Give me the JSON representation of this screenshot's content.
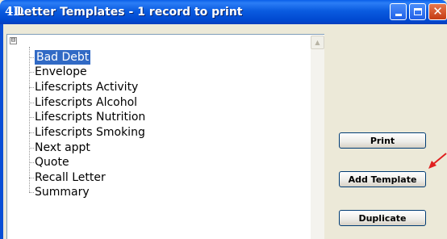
{
  "window": {
    "app_logo": "4D",
    "title": "Letter Templates - 1 record to print"
  },
  "tree": {
    "root_toggle": "⊟",
    "items": [
      {
        "label": "Bad Debt",
        "selected": true
      },
      {
        "label": "Envelope"
      },
      {
        "label": "Lifescripts Activity"
      },
      {
        "label": "Lifescripts Alcohol"
      },
      {
        "label": "Lifescripts Nutrition"
      },
      {
        "label": "Lifescripts Smoking"
      },
      {
        "label": "Next appt"
      },
      {
        "label": "Quote"
      },
      {
        "label": "Recall Letter"
      },
      {
        "label": "Summary"
      }
    ]
  },
  "buttons": {
    "print": "Print",
    "add_template": "Add Template",
    "duplicate": "Duplicate"
  },
  "colors": {
    "title_bar": "#0a5be0",
    "selection": "#316ac5",
    "annotation_arrow": "#e02020"
  }
}
